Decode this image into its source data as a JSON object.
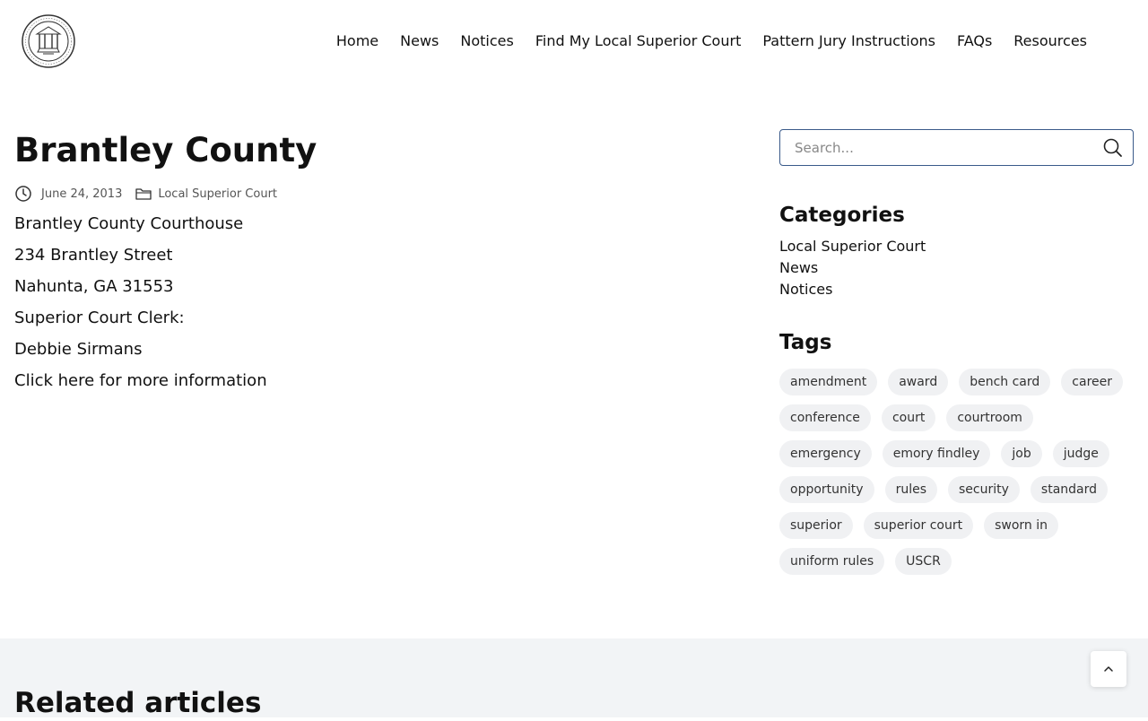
{
  "nav": {
    "items": [
      {
        "label": "Home"
      },
      {
        "label": "News"
      },
      {
        "label": "Notices"
      },
      {
        "label": "Find My Local Superior Court"
      },
      {
        "label": "Pattern Jury Instructions"
      },
      {
        "label": "FAQs"
      },
      {
        "label": "Resources"
      }
    ]
  },
  "article": {
    "title": "Brantley County",
    "date": "June 24, 2013",
    "category": "Local Superior Court",
    "lines": [
      "Brantley County Courthouse",
      "234 Brantley Street",
      "Nahunta, GA 31553",
      "Superior Court Clerk:",
      "Debbie Sirmans",
      "Click here for more information"
    ]
  },
  "sidebar": {
    "search_placeholder": "Search...",
    "categories_heading": "Categories",
    "categories": [
      "Local Superior Court",
      "News",
      "Notices"
    ],
    "tags_heading": "Tags",
    "tags": [
      "amendment",
      "award",
      "bench card",
      "career",
      "conference",
      "court",
      "courtroom",
      "emergency",
      "emory findley",
      "job",
      "judge",
      "opportunity",
      "rules",
      "security",
      "standard",
      "superior",
      "superior court",
      "sworn in",
      "uniform rules",
      "USCR"
    ]
  },
  "related": {
    "heading": "Related articles"
  },
  "icons": {
    "logo": "georgia-state-seal",
    "date": "clock-icon",
    "category": "folder-icon",
    "search": "search-icon",
    "top": "chevron-up-icon"
  },
  "colors": {
    "search_border": "#3a5a8a",
    "tag_bg": "#f0f1f3",
    "related_bg": "#f2f4f6"
  }
}
